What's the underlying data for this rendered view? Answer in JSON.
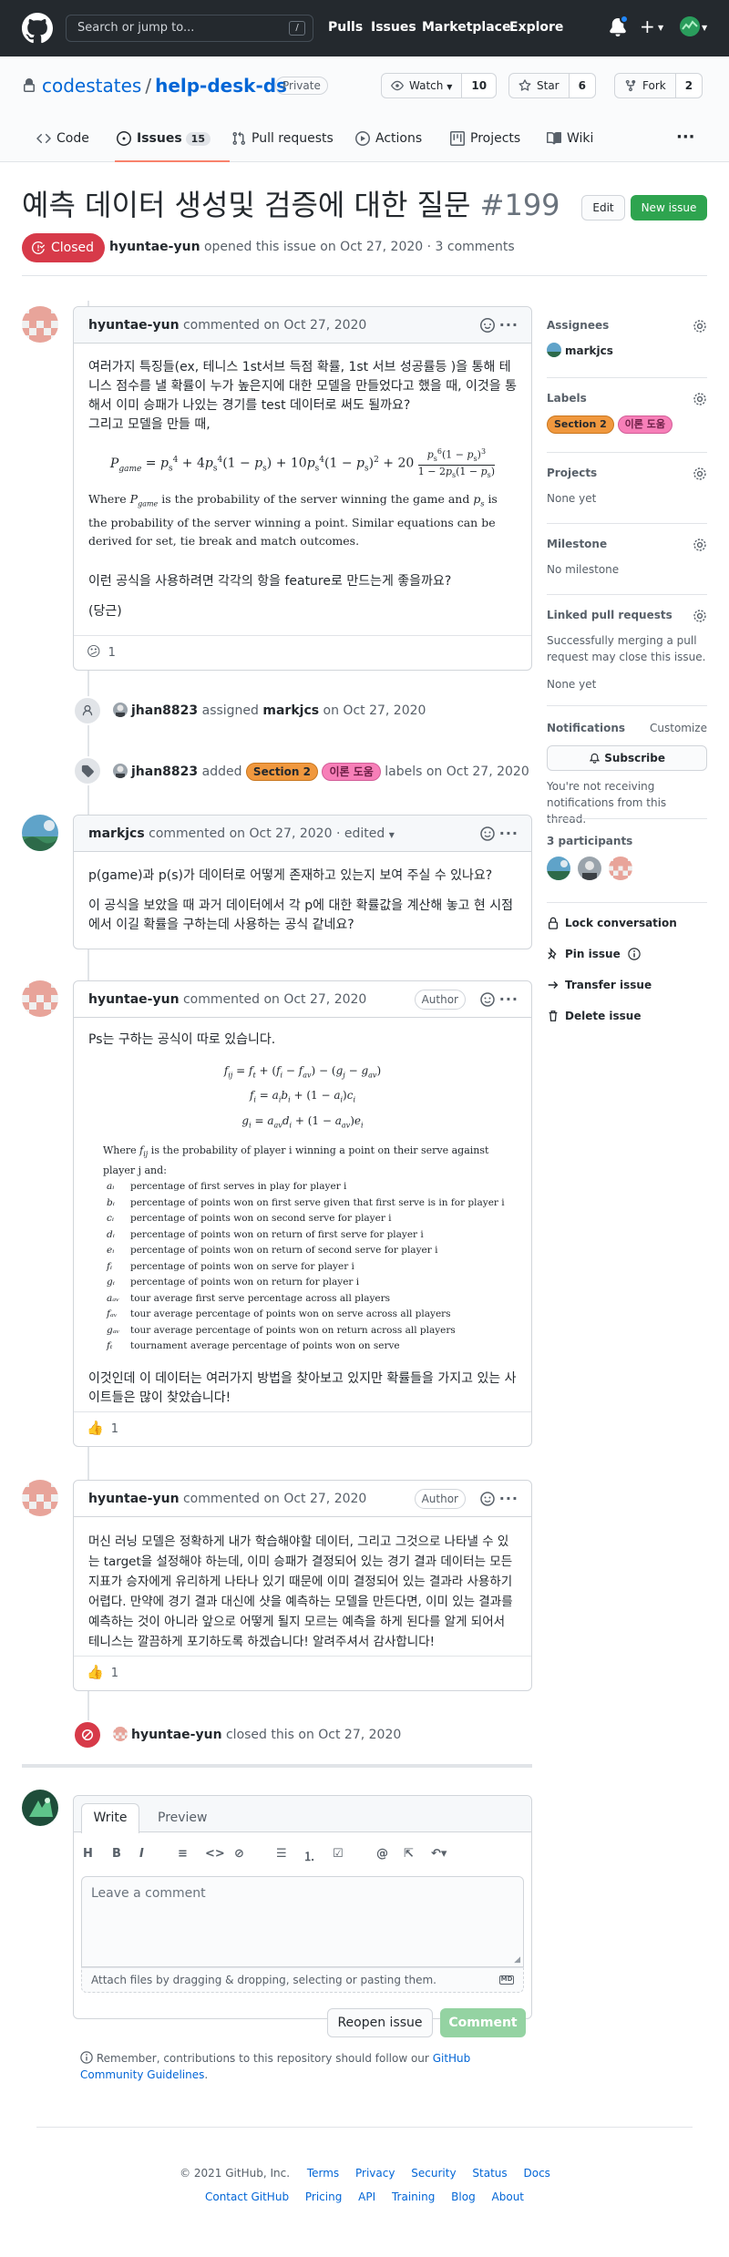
{
  "header": {
    "search_placeholder": "Search or jump to...",
    "slash_key": "/",
    "nav": [
      "Pulls",
      "Issues",
      "Marketplace",
      "Explore"
    ]
  },
  "repo": {
    "owner": "codestates",
    "name": "help-desk-ds",
    "visibility": "Private",
    "watch_label": "Watch",
    "watch_count": "10",
    "star_label": "Star",
    "star_count": "6",
    "fork_label": "Fork",
    "fork_count": "2",
    "tabs": [
      {
        "label": "Code"
      },
      {
        "label": "Issues",
        "count": "15"
      },
      {
        "label": "Pull requests"
      },
      {
        "label": "Actions"
      },
      {
        "label": "Projects"
      },
      {
        "label": "Wiki"
      }
    ],
    "more": "···"
  },
  "issue": {
    "title": "예측 데이터 생성및 검증에 대한 질문",
    "number": "#199",
    "edit_label": "Edit",
    "new_issue_label": "New issue",
    "state": "Closed",
    "author": "hyuntae-yun",
    "meta_rest": "opened this issue on Oct 27, 2020 · 3 comments"
  },
  "comments": [
    {
      "author": "hyuntae-yun",
      "action": "commented on Oct 27, 2020",
      "p1": "여러가지 특징들(ex, 테니스 1st서브 득점 확률, 1st 서브 성공률등 )을 통해 테니스 점수를 낼 확률이 누가 높은지에 대한 모델을 만들었다고 했을 때, 이것을 통해서 이미 승패가 나있는 경기를 test 데이터로 써도 될까요?",
      "p2": "그리고 모델을 만들 때,",
      "math_text": "is the probability of the server winning the game and",
      "math_text2": "is the probability of the server winning a point.  Similar equations can be derived for set, tie break and match outcomes.",
      "p3": "이런 공식을 사용하려면 각각의 항을 feature로 만드는게 좋을까요?",
      "p4": "(당근)",
      "reaction_emoji": "😕",
      "reaction_count": "1"
    },
    {
      "author": "markjcs",
      "action": "commented on Oct 27, 2020 · edited",
      "p1": "p(game)과 p(s)가 데이터로 어떻게 존재하고 있는지 보여 주실 수 있나요?",
      "p2": "이 공식을 보았을 때 과거 데이터에서 각 p에 대한 확률값을 계산해 놓고 현 시점에서 이길 확률을 구하는데 사용하는 공식 같네요?"
    },
    {
      "author": "hyuntae-yun",
      "action": "commented on Oct 27, 2020",
      "badge": "Author",
      "p1": "Ps는 구하는 공식이 따로 있습니다.",
      "where_text": "is the probability of player i winning a point on their serve against player j and:",
      "defs": [
        {
          "sym": "aᵢ",
          "text": "percentage of first serves in play for player i"
        },
        {
          "sym": "bᵢ",
          "text": "percentage of points won on first serve given that first serve is in for player i"
        },
        {
          "sym": "cᵢ",
          "text": "percentage of points won on second serve for player i"
        },
        {
          "sym": "dᵢ",
          "text": "percentage of points won on return of first serve for player i"
        },
        {
          "sym": "eᵢ",
          "text": "percentage of points won on return of second serve for player i"
        },
        {
          "sym": "fᵢ",
          "text": "percentage of points won on serve for player i"
        },
        {
          "sym": "gᵢ",
          "text": "percentage of points won on return for player i"
        },
        {
          "sym": "aₐᵥ",
          "text": "tour average first serve percentage across all players"
        },
        {
          "sym": "fₐᵥ",
          "text": "tour average percentage of points won on serve across all players"
        },
        {
          "sym": "gₐᵥ",
          "text": "tour average percentage of points won on return across all players"
        },
        {
          "sym": "fₜ",
          "text": "tournament average percentage of points won on serve"
        }
      ],
      "p2": "이것인데 이 데이터는 여러가지 방법을 찾아보고 있지만 확률들을 가지고 있는 사이트들은 많이 찾았습니다!",
      "reaction_emoji": "👍",
      "reaction_count": "1"
    },
    {
      "author": "hyuntae-yun",
      "action": "commented on Oct 27, 2020",
      "badge": "Author",
      "p1": "머신 러닝 모델은 정확하게 내가 학습해야할 데이터, 그리고 그것으로 나타낼 수 있는 target을 설정해야 하는데, 이미 승패가 결정되어 있는 경기 결과 데이터는 모든 지표가 승자에게 유리하게 나타나 있기 때문에 이미 결정되어 있는 결과라 사용하기 어렵다. 만약에 경기 결과 대신에 샷을 예측하는 모델을 만든다면, 이미 있는 결과를 예측하는 것이 아니라 앞으로 어떻게 될지 모르는 예측을 하게 된다를 알게 되어서 테니스는 깔끔하게 포기하도록 하겠습니다! 알려주셔서 감사합니다!",
      "reaction_emoji": "👍",
      "reaction_count": "1"
    }
  ],
  "events": {
    "assign": {
      "actor": "jhan8823",
      "verb": "assigned",
      "target": "markjcs",
      "when": "on Oct 27, 2020"
    },
    "label": {
      "actor": "jhan8823",
      "verb": "added",
      "labels": [
        "Section 2",
        "이론 도움"
      ],
      "rest": "labels on Oct 27, 2020"
    },
    "close": {
      "actor": "hyuntae-yun",
      "rest": "closed this on Oct 27, 2020"
    }
  },
  "sidebar": {
    "assignees_h": "Assignees",
    "assignee": "markjcs",
    "labels_h": "Labels",
    "labels": [
      "Section 2",
      "이론 도움"
    ],
    "projects_h": "Projects",
    "projects_v": "None yet",
    "milestone_h": "Milestone",
    "milestone_v": "No milestone",
    "linked_h": "Linked pull requests",
    "linked_t": "Successfully merging a pull request may close this issue.",
    "linked_v": "None yet",
    "notifications_h": "Notifications",
    "customize": "Customize",
    "subscribe": "Subscribe",
    "notify_t": "You're not receiving notifications from this thread.",
    "participants_h": "3 participants",
    "lock": "Lock conversation",
    "pin": "Pin issue",
    "transfer": "Transfer issue",
    "delete": "Delete issue"
  },
  "composer": {
    "tab_write": "Write",
    "tab_preview": "Preview",
    "placeholder": "Leave a comment",
    "attach": "Attach files by dragging & dropping, selecting or pasting them.",
    "md_badge": "MD",
    "reopen": "Reopen issue",
    "comment": "Comment",
    "remember_pre": "Remember, contributions to this repository should follow our",
    "remember_link": "GitHub Community Guidelines",
    "remember_post": "."
  },
  "footer": {
    "copyright": "© 2021 GitHub, Inc.",
    "row1": [
      "Terms",
      "Privacy",
      "Security",
      "Status",
      "Docs"
    ],
    "row2": [
      "Contact GitHub",
      "Pricing",
      "API",
      "Training",
      "Blog",
      "About"
    ]
  },
  "colors": {
    "closed": "#d73a49",
    "accent": "#0366d6",
    "green": "#2ea44f",
    "header": "#24292e"
  }
}
